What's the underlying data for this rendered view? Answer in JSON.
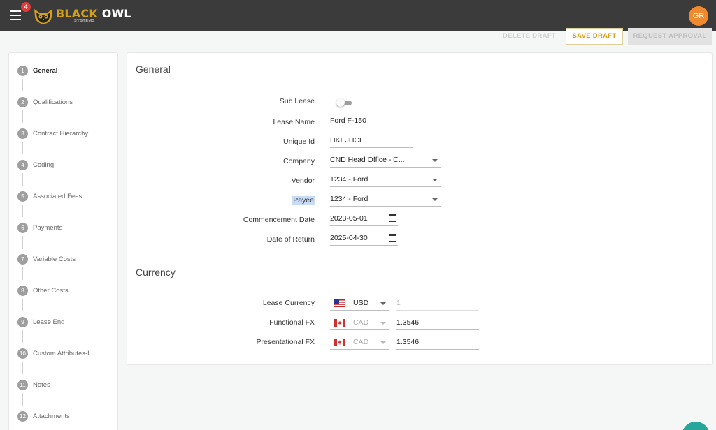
{
  "header": {
    "menu_badge": "4",
    "logo_black": "BLACK",
    "logo_owl": "OWL",
    "logo_sub": "SYSTEMS",
    "avatar_initials": "GR"
  },
  "actions": {
    "delete_label": "DELETE DRAFT",
    "save_label": "SAVE DRAFT",
    "request_label": "REQUEST APPROVAL"
  },
  "steps": [
    {
      "num": "1",
      "label": "General"
    },
    {
      "num": "2",
      "label": "Qualifications"
    },
    {
      "num": "3",
      "label": "Contract Hierarchy"
    },
    {
      "num": "4",
      "label": "Coding"
    },
    {
      "num": "5",
      "label": "Associated Fees"
    },
    {
      "num": "6",
      "label": "Payments"
    },
    {
      "num": "7",
      "label": "Variable Costs"
    },
    {
      "num": "8",
      "label": "Other Costs"
    },
    {
      "num": "9",
      "label": "Lease End"
    },
    {
      "num": "10",
      "label": "Custom Attributes-L"
    },
    {
      "num": "11",
      "label": "Notes"
    },
    {
      "num": "12",
      "label": "Attachments"
    }
  ],
  "general": {
    "title": "General",
    "sub_lease_label": "Sub Lease",
    "lease_name_label": "Lease Name",
    "lease_name_value": "Ford F-150",
    "unique_id_label": "Unique Id",
    "unique_id_value": "HKEJHCE",
    "company_label": "Company",
    "company_value": "CND Head Office - C...",
    "vendor_label": "Vendor",
    "vendor_value": "1234 - Ford",
    "payee_label": "Payee",
    "payee_value": "1234 - Ford",
    "commencement_label": "Commencement Date",
    "commencement_value": "2023-05-01",
    "return_label": "Date of Return",
    "return_value": "2025-04-30"
  },
  "currency": {
    "title": "Currency",
    "lease_currency_label": "Lease Currency",
    "lease_currency_code": "USD",
    "lease_currency_rate": "1",
    "functional_label": "Functional FX",
    "functional_code": "CAD",
    "functional_rate": "1.3546",
    "presentational_label": "Presentational FX",
    "presentational_code": "CAD",
    "presentational_rate": "1.3546"
  },
  "colors": {
    "topbar": "#3b3b3b",
    "accent": "#d4a017",
    "avatar": "#ef8a2e"
  }
}
